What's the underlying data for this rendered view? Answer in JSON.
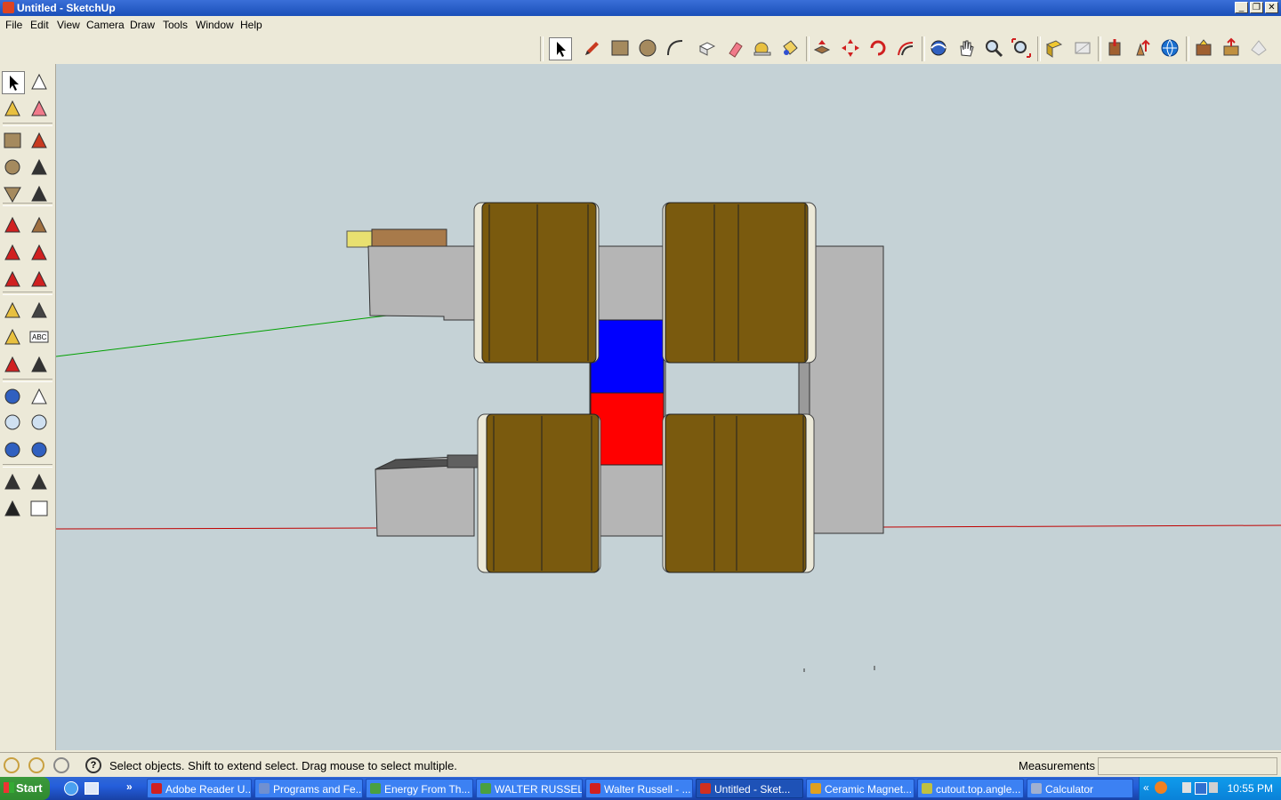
{
  "window": {
    "title": "Untitled - SketchUp",
    "controls": [
      "minimize",
      "restore",
      "close"
    ]
  },
  "menu": [
    "File",
    "Edit",
    "View",
    "Camera",
    "Draw",
    "Tools",
    "Window",
    "Help"
  ],
  "toolbar_top": {
    "icons": [
      "select-icon",
      "pencil-icon",
      "rectangle-icon",
      "circle-icon",
      "arc-icon",
      "make-component-icon",
      "eraser-icon",
      "tape-measure-icon",
      "paint-bucket-icon",
      "push-pull-icon",
      "move-icon",
      "rotate-icon",
      "follow-me-icon",
      "orbit-icon",
      "pan-icon",
      "zoom-icon",
      "zoom-extents-icon",
      "previous-view-icon",
      "next-view-icon",
      "get-models-icon",
      "share-model-icon",
      "google-earth-icon",
      "get-components-icon",
      "share-component-icon",
      "place-model-icon"
    ]
  },
  "toolbar_left": {
    "icons": [
      "select-icon",
      "make-component-icon",
      "paint-bucket-icon",
      "eraser-icon",
      "rectangle-icon",
      "pencil-icon",
      "circle-icon",
      "arc-icon",
      "polygon-icon",
      "freehand-icon",
      "move-icon",
      "push-pull-icon",
      "rotate-icon",
      "follow-me-icon",
      "scale-icon",
      "offset-icon",
      "tape-measure-icon",
      "dimension-icon",
      "protractor-icon",
      "text-icon",
      "axes-icon",
      "3d-text-icon",
      "orbit-icon",
      "pan-icon",
      "zoom-icon",
      "zoom-window-icon",
      "previous-icon",
      "zoom-extents-icon",
      "position-camera-icon",
      "look-around-icon",
      "walk-icon",
      "section-plane-icon"
    ],
    "abc_label": "ABC"
  },
  "model": {
    "colors": {
      "sky": "#c5d2d6",
      "core_gray": "#b3b3b3",
      "coil_brown": "#7a5a0e",
      "magnet_blue": "#0000ff",
      "magnet_red": "#ff0000",
      "axis_green": "#00a000",
      "axis_red": "#c00000"
    }
  },
  "status": {
    "hint": "Select objects. Shift to extend select. Drag mouse to select multiple.",
    "measurements_label": "Measurements",
    "measurements_value": ""
  },
  "taskbar": {
    "start": "Start",
    "tasks": [
      "Adobe Reader U...",
      "Programs and Fe...",
      "Energy From Th...",
      "WALTER RUSSELL",
      "Walter Russell - ...",
      "Untitled - Sket...",
      "Ceramic Magnet...",
      "cutout.top.angle...",
      "Calculator"
    ],
    "active_task": "Untitled - Sket...",
    "clock": "10:55 PM"
  }
}
